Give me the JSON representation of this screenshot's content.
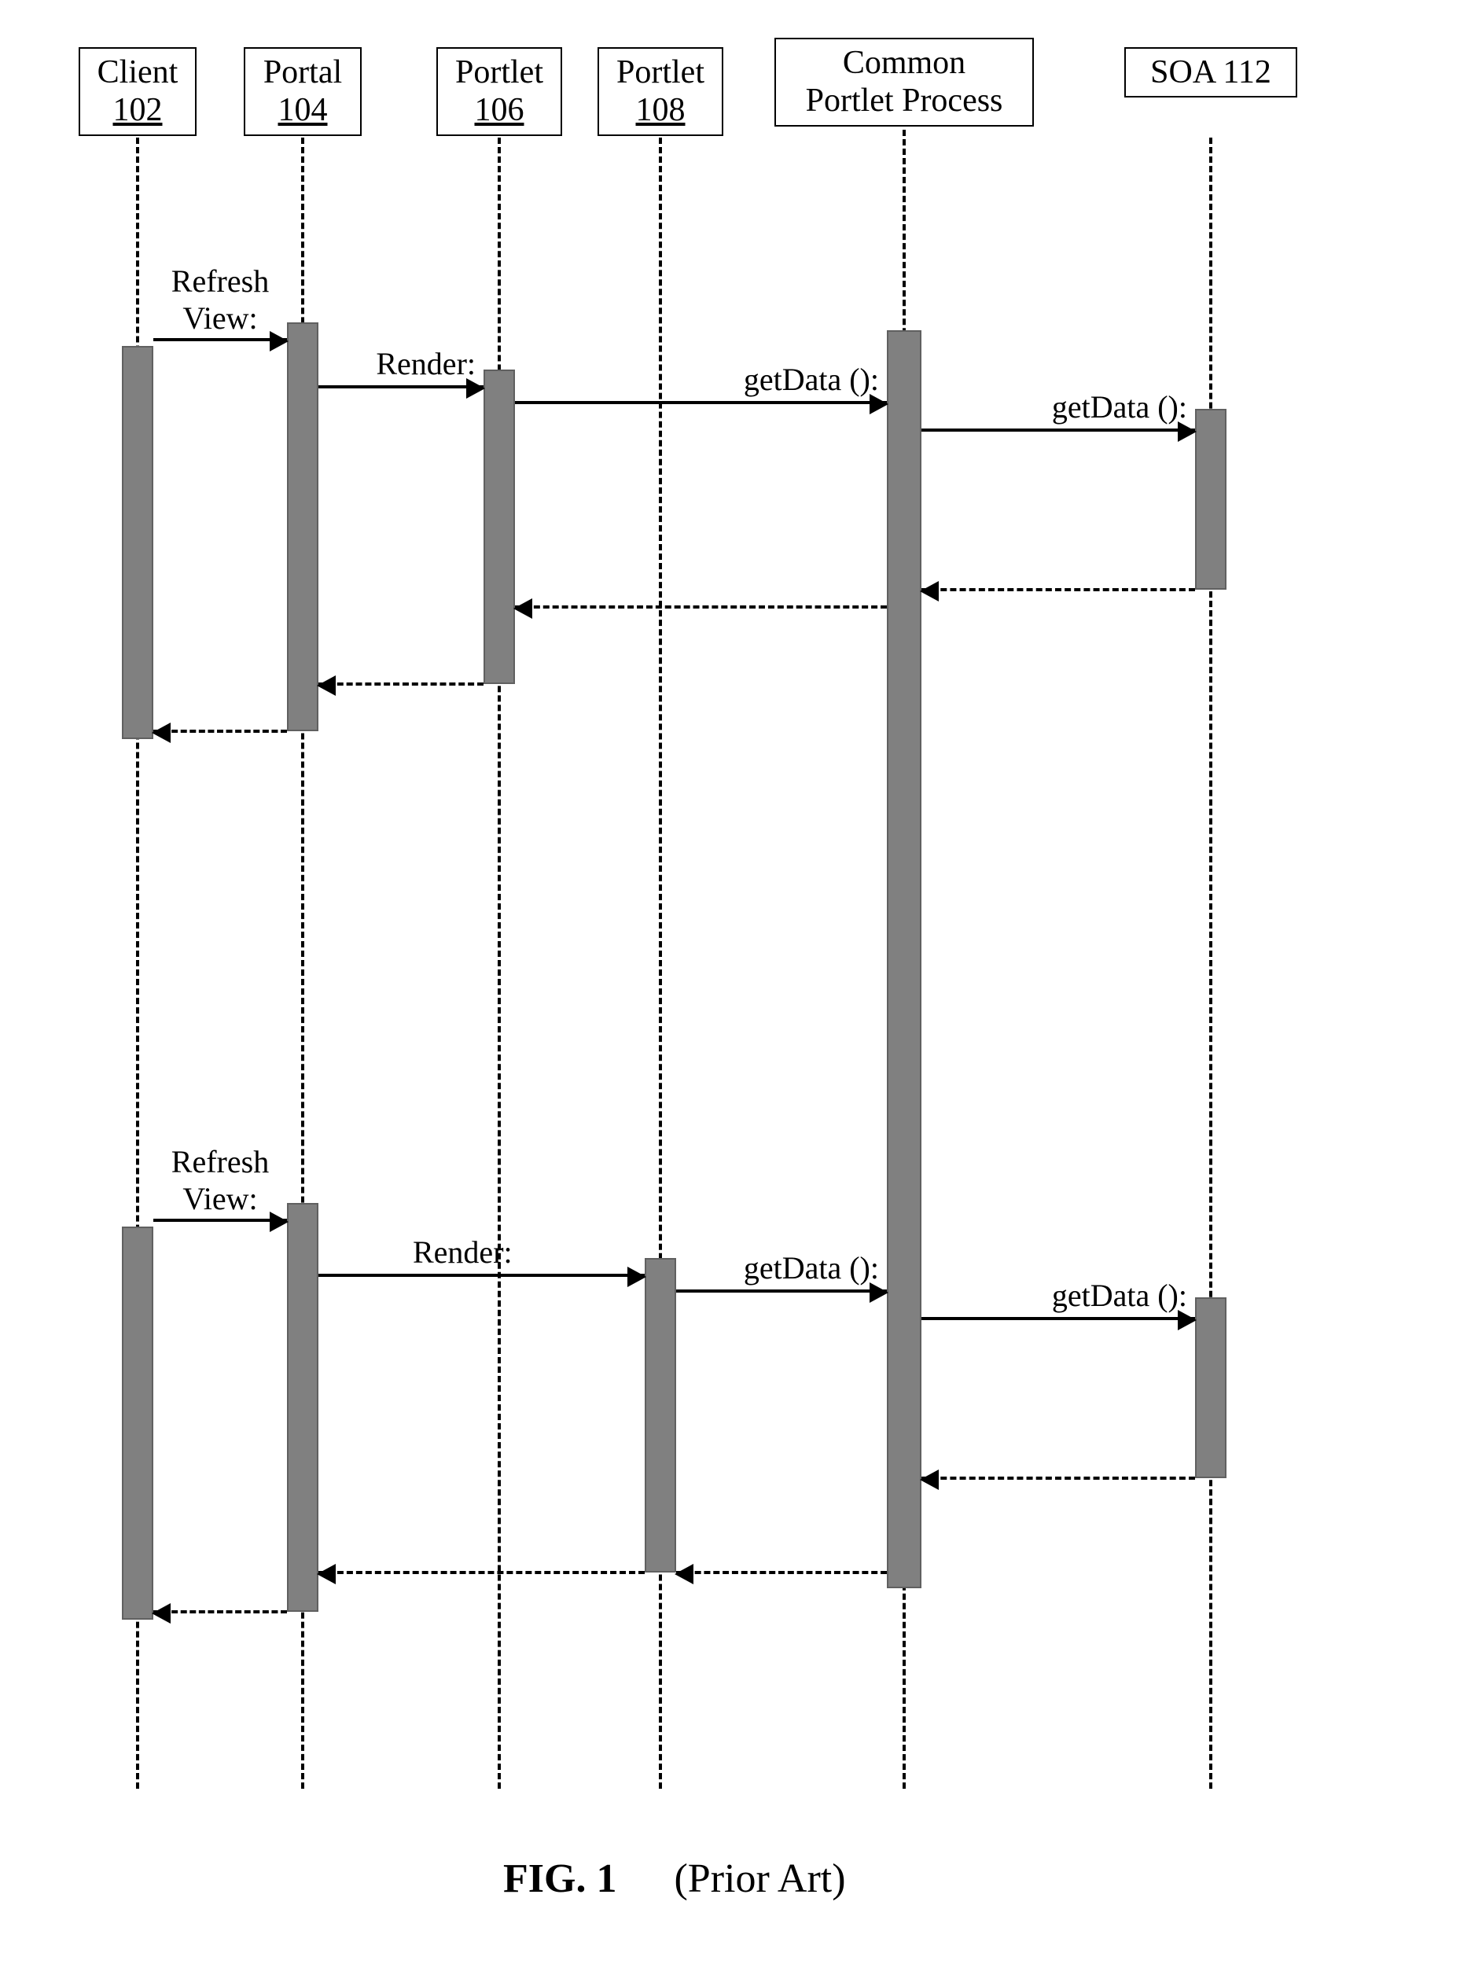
{
  "participants": {
    "client": {
      "line1": "Client",
      "line2": "102"
    },
    "portal": {
      "line1": "Portal",
      "line2": "104"
    },
    "portlet1": {
      "line1": "Portlet",
      "line2": "106"
    },
    "portlet2": {
      "line1": "Portlet",
      "line2": "108"
    },
    "cpp": {
      "line1": "Common",
      "line2": "Portlet Process"
    },
    "soa": {
      "line1": "SOA 112"
    }
  },
  "messages": {
    "refresh1_l1": "Refresh",
    "refresh1_l2": "View:",
    "render1": "Render:",
    "getdata1a": "getData ():",
    "getdata1b": "getData ():",
    "refresh2_l1": "Refresh",
    "refresh2_l2": "View:",
    "render2": "Render:",
    "getdata2a": "getData ():",
    "getdata2b": "getData ():"
  },
  "caption": {
    "fig": "FIG. 1",
    "pa": "(Prior Art)"
  },
  "chart_data": {
    "type": "sequence-diagram",
    "participants": [
      {
        "id": "client",
        "label": "Client 102"
      },
      {
        "id": "portal",
        "label": "Portal 104"
      },
      {
        "id": "portlet1",
        "label": "Portlet 106"
      },
      {
        "id": "portlet2",
        "label": "Portlet 108"
      },
      {
        "id": "cpp",
        "label": "Common Portlet Process"
      },
      {
        "id": "soa",
        "label": "SOA 112"
      }
    ],
    "interactions": [
      {
        "seq": 1,
        "from": "client",
        "to": "portal",
        "kind": "call",
        "label": "Refresh View:"
      },
      {
        "seq": 2,
        "from": "portal",
        "to": "portlet1",
        "kind": "call",
        "label": "Render:"
      },
      {
        "seq": 3,
        "from": "portlet1",
        "to": "cpp",
        "kind": "call",
        "label": "getData ():"
      },
      {
        "seq": 4,
        "from": "cpp",
        "to": "soa",
        "kind": "call",
        "label": "getData ():"
      },
      {
        "seq": 5,
        "from": "soa",
        "to": "cpp",
        "kind": "return",
        "label": ""
      },
      {
        "seq": 6,
        "from": "cpp",
        "to": "portlet1",
        "kind": "return",
        "label": ""
      },
      {
        "seq": 7,
        "from": "portlet1",
        "to": "portal",
        "kind": "return",
        "label": ""
      },
      {
        "seq": 8,
        "from": "portal",
        "to": "client",
        "kind": "return",
        "label": ""
      },
      {
        "seq": 9,
        "from": "client",
        "to": "portal",
        "kind": "call",
        "label": "Refresh View:"
      },
      {
        "seq": 10,
        "from": "portal",
        "to": "portlet2",
        "kind": "call",
        "label": "Render:"
      },
      {
        "seq": 11,
        "from": "portlet2",
        "to": "cpp",
        "kind": "call",
        "label": "getData ():"
      },
      {
        "seq": 12,
        "from": "cpp",
        "to": "soa",
        "kind": "call",
        "label": "getData ():"
      },
      {
        "seq": 13,
        "from": "soa",
        "to": "cpp",
        "kind": "return",
        "label": ""
      },
      {
        "seq": 14,
        "from": "cpp",
        "to": "portlet2",
        "kind": "return",
        "label": ""
      },
      {
        "seq": 15,
        "from": "portlet2",
        "to": "portal",
        "kind": "return",
        "label": ""
      },
      {
        "seq": 16,
        "from": "portal",
        "to": "client",
        "kind": "return",
        "label": ""
      }
    ],
    "note": "Two identical refresh sequences demonstrating redundant SOA getData() calls via Common Portlet Process (prior art)."
  }
}
